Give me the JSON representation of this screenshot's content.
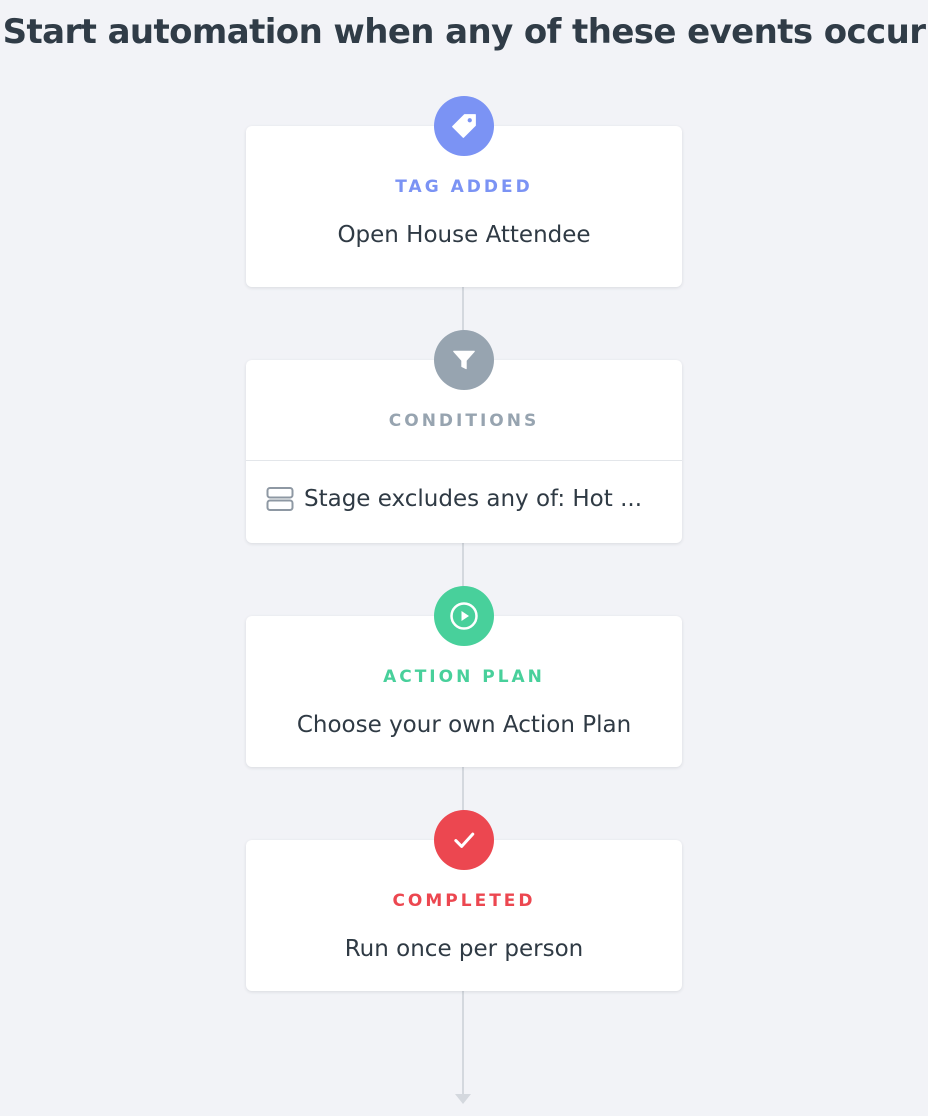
{
  "header": {
    "title": "Start automation when any of these events occur"
  },
  "steps": [
    {
      "label": "TAG ADDED",
      "value": "Open House Attendee",
      "icon": "tag-icon",
      "color": "#7b93f4"
    },
    {
      "label": "CONDITIONS",
      "icon": "filter-icon",
      "color": "#97a4b0",
      "condition": {
        "icon": "stage-icon",
        "text": "Stage excludes any of: Hot ..."
      }
    },
    {
      "label": "ACTION PLAN",
      "value": "Choose your own Action Plan",
      "icon": "play-circle-icon",
      "color": "#48d09b"
    },
    {
      "label": "COMPLETED",
      "value": "Run once per person",
      "icon": "checkmark-icon",
      "color": "#ec4750"
    }
  ]
}
